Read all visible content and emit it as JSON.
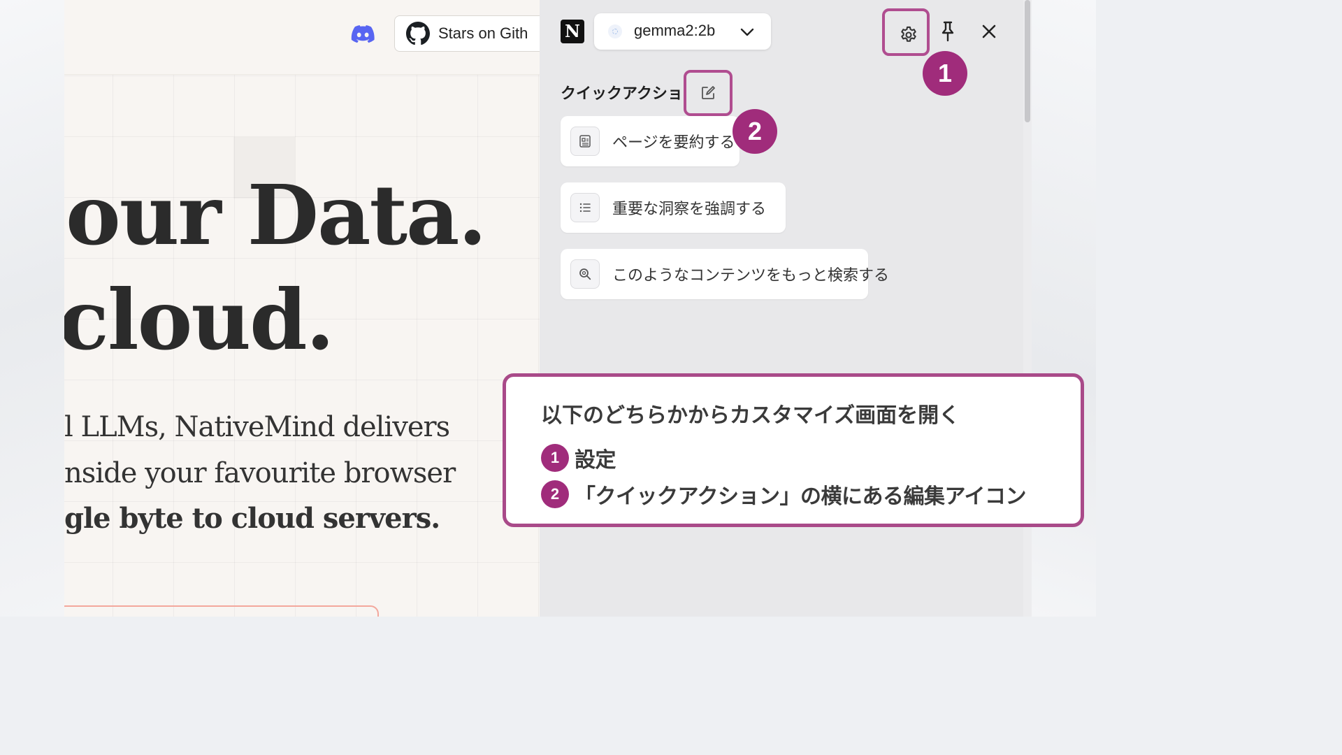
{
  "website": {
    "github_button_label": "Stars on Gith",
    "hero_line_1": "our Data.",
    "hero_line_2": "cloud.",
    "subtitle_line_1": "l LLMs, NativeMind delivers",
    "subtitle_line_2": "nside your favourite browser",
    "subtitle_line_3": "gle byte to cloud servers."
  },
  "panel": {
    "notion_logo": "N",
    "model_selector": {
      "value": "gemma2:2b"
    },
    "quick_actions_title": "クイックアクション",
    "quick_actions": [
      {
        "label": "ページを要約する",
        "icon": "newspaper-icon"
      },
      {
        "label": "重要な洞察を強調する",
        "icon": "list-icon"
      },
      {
        "label": "このようなコンテンツをもっと検索する",
        "icon": "search-icon"
      }
    ]
  },
  "annotations": {
    "badge_1": "1",
    "badge_2": "2",
    "accent_color": "#a02c7b"
  },
  "callout": {
    "title": "以下のどちらかからカスタマイズ画面を開く",
    "items": [
      {
        "number": "1",
        "text": "設定"
      },
      {
        "number": "2",
        "text": "「クイックアクション」の横にある編集アイコン"
      }
    ]
  }
}
